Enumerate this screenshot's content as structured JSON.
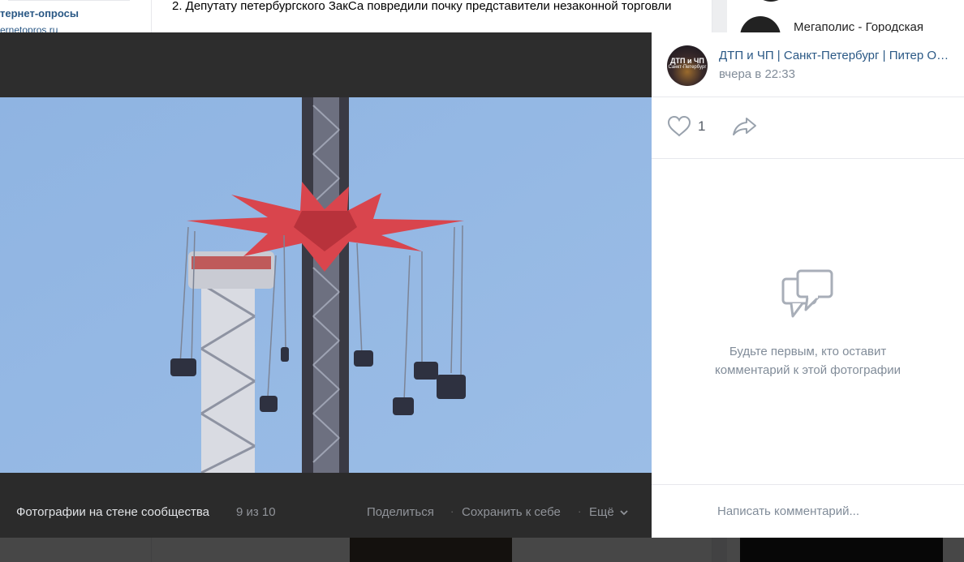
{
  "background": {
    "left_link": "тернет-опросы",
    "left_sub": "ernetopros.ru",
    "news_item": "2. Депутату петербургского ЗакСа повредили почку представители незаконной торговли",
    "right_item": "Мегаполис - Городская"
  },
  "viewer": {
    "album_title": "Фотографии на стене сообщества",
    "counter": "9 из 10",
    "actions": {
      "share": "Поделиться",
      "save": "Сохранить к себе",
      "more": "Ещё"
    },
    "separator": "·"
  },
  "side": {
    "group_name": "ДТП и ЧП | Санкт-Петербург | Питер Онлайн | СПб",
    "time": "вчера в 22:33",
    "avatar_line1": "ДТП и ЧП",
    "avatar_line2": "Санкт-Петербург",
    "likes_count": "1",
    "empty_line1": "Будьте первым, кто оставит",
    "empty_line2": "комментарий к этой фотографии",
    "comment_placeholder": "Написать комментарий..."
  },
  "colors": {
    "link": "#2a5885",
    "muted": "#818c99",
    "icon": "#99a2ad",
    "sky": "#92b7e3",
    "canopy": "#d9454d"
  }
}
